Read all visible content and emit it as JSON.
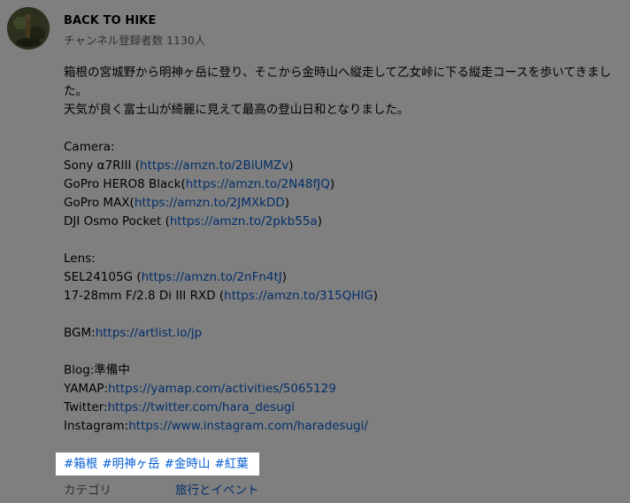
{
  "channel": {
    "name": "BACK TO HIKE",
    "subscribers": "チャンネル登録者数 1130人"
  },
  "description": {
    "intro_line1": "箱根の宮城野から明神ヶ岳に登り、そこから金時山へ縦走して乙女峠に下る縦走コースを歩いてきました。",
    "intro_line2": "天気が良く富士山が綺麗に見えて最高の登山日和となりました。",
    "camera_heading": "Camera:",
    "cameras": [
      {
        "prefix": "Sony α7RIII (",
        "url": "https://amzn.to/2BiUMZv",
        "suffix": ")"
      },
      {
        "prefix": "GoPro HERO8 Black(",
        "url": "https://amzn.to/2N48fJQ",
        "suffix": ")"
      },
      {
        "prefix": "GoPro MAX(",
        "url": "https://amzn.to/2JMXkDD",
        "suffix": ")"
      },
      {
        "prefix": "DJI Osmo Pocket (",
        "url": "https://amzn.to/2pkb55a",
        "suffix": ")"
      }
    ],
    "lens_heading": "Lens:",
    "lenses": [
      {
        "prefix": "SEL24105G (",
        "url": "https://amzn.to/2nFn4tJ",
        "suffix": ")"
      },
      {
        "prefix": "17-28mm F/2.8 Di III RXD (",
        "url": "https://amzn.to/315QHlG",
        "suffix": ")"
      }
    ],
    "bgm": {
      "prefix": "BGM:",
      "url": "https://artlist.io/jp"
    },
    "blog": "Blog:準備中",
    "yamap": {
      "prefix": "YAMAP:",
      "url": "https://yamap.com/activities/5065129"
    },
    "twitter": {
      "prefix": "Twitter:",
      "url": "https://twitter.com/hara_desugi"
    },
    "instagram": {
      "prefix": "Instagram:",
      "url": "https://www.instagram.com/haradesugi/"
    }
  },
  "hashtags": [
    "#箱根",
    "#明神ヶ岳",
    "#金時山",
    "#紅葉"
  ],
  "category": {
    "label": "カテゴリ",
    "value": "旅行とイベント"
  },
  "colors": {
    "link": "#065fd4",
    "overlay": "rgba(0,0,0,0.5)",
    "secondary_text": "#606060"
  }
}
